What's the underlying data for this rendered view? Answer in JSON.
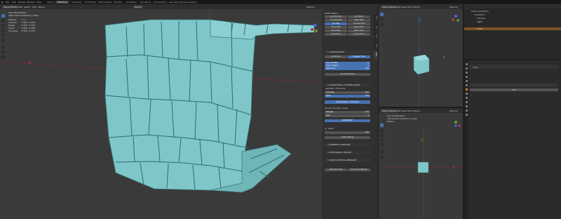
{
  "app": {
    "menus": [
      "File",
      "Edit",
      "Render",
      "Window",
      "Help"
    ],
    "workspaces": [
      "Layout",
      "Modeling",
      "Sculpting",
      "UV Editing",
      "Texture Paint",
      "Shading",
      "Animation",
      "Rendering",
      "Compositing",
      "Geometry Nodes",
      "Scripting"
    ],
    "active_workspace": "Modeling"
  },
  "main_viewport": {
    "mode": "Object Mode",
    "menus": [
      "View",
      "Select",
      "Add",
      "Object"
    ],
    "transform": "Global",
    "options": "Options",
    "overlay_title": "User Perspective",
    "overlay_sub": "(18) Scene Collection | Cube",
    "stats": [
      {
        "label": "Objects",
        "value": "1 / 1"
      },
      {
        "label": "Vertices",
        "value": "1,696 / 1,696"
      },
      {
        "label": "Edges",
        "value": "3,362 / 3,362"
      },
      {
        "label": "Faces",
        "value": "1,668 / 1,668"
      },
      {
        "label": "Triangles",
        "value": "3,336 / 3,336"
      }
    ],
    "axis_x": "X"
  },
  "addon_panel": {
    "title": "RUIN TOOLS",
    "grid_buttons": [
      "Low Poly Ruin",
      "Print Ruin",
      "Crumble Wall",
      "Brick Wall",
      "Tile Wall",
      "Cracked Wall",
      "Stone Wall",
      "Stone Floor",
      "Rock Wall",
      "Gothic Ruin",
      "Balustrade",
      "Custom Ruin"
    ],
    "active_grid_button": "Tile Wall",
    "section1": "1. PATTERN SETUP",
    "pattern_buttons": [
      "Rectangles",
      "Irregular Tiles"
    ],
    "fields": [
      {
        "label": "Tiles X (Width)",
        "value": "12"
      },
      {
        "label": "Tiles Y (Height)",
        "value": "6"
      },
      {
        "label": "Mortar Gap",
        "value": "0.02"
      }
    ],
    "generate_button": "Generate Pattern",
    "section2": "2. INSTANCE DETAIL / THICKNESS & BEVEL",
    "section2_sub": "Geometry / Thickness",
    "fields2": [
      {
        "label": "Thickness",
        "value": "0.10"
      },
      {
        "label": "Bevel",
        "value": "0.01"
      }
    ],
    "apply_button": "Solidify Bevel + Thickness",
    "subtitle": "Random Strength & Seed",
    "fields3": [
      {
        "label": "Strength",
        "value": "0.15"
      },
      {
        "label": "Seed",
        "value": "4"
      }
    ],
    "randomize_button": "RANDOMIZE",
    "check_label": "Detail",
    "check_value": "0.50",
    "apply_settings_button": "Apply Settings",
    "section3": "3. GEOMETRY VARIATION",
    "section4": "4. EDGE WEAR & DAMAGE",
    "section5": "5. COLOR & MATERIAL APPEARANCE",
    "bottom_buttons": [
      "Reset All Props",
      "Export All Settings"
    ],
    "side_tabs": [
      "Item",
      "Tool",
      "View",
      "Edit",
      "Ruin"
    ]
  },
  "right_top_viewport": {
    "mode": "Object Mode",
    "menus": [
      "View",
      "Select",
      "Add",
      "Object"
    ],
    "options": "Options",
    "axes": {
      "y": "Y",
      "z": "Z"
    }
  },
  "right_bottom_viewport": {
    "mode": "Object Mode",
    "menus": [
      "View",
      "Select",
      "Add",
      "Object"
    ],
    "options": "Options",
    "overlay_title": "Top Orthographic",
    "overlay_sub": "(18) Scene Collection | Cube",
    "overlay_units": "Meters",
    "axes": {
      "x": "X",
      "y": "Y"
    }
  },
  "outliner": {
    "title": "Scene Collection",
    "items": [
      "Collection",
      "Camera",
      "Light",
      "Cube"
    ],
    "selected": "Cube"
  },
  "properties": {
    "sub_header": "Cube",
    "panel_label": "Add"
  },
  "colors": {
    "accent": "#4772b3",
    "mesh": "#7fc6c9",
    "selected": "#e8841a",
    "axis_x": "#c0334a",
    "axis_y": "#6ea021",
    "axis_z": "#3a6dd8"
  }
}
